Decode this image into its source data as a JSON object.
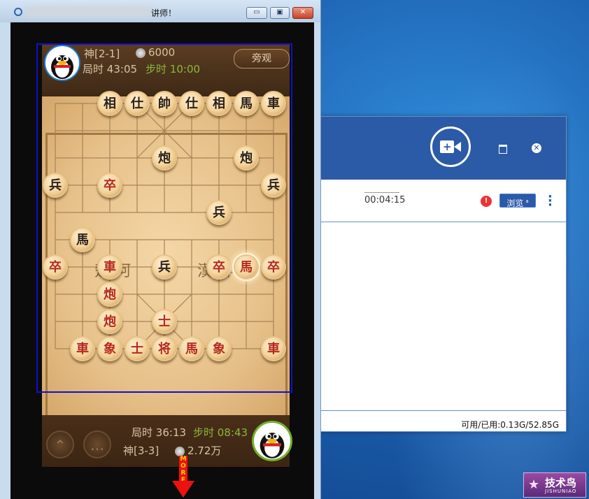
{
  "game_window": {
    "title_suffix": "讲师！",
    "controls": {
      "minimize": "▭",
      "maximize": "▣",
      "close": "✕"
    }
  },
  "top_player": {
    "rank": "神[2-1]",
    "coins": "6000",
    "game_time_label": "局时",
    "game_time": "43:05",
    "step_time_label": "步时",
    "step_time": "10:00"
  },
  "spectate_button": "旁观",
  "river": {
    "left": "楚河",
    "right": "漢界"
  },
  "bottom_player": {
    "rank": "神[3-3]",
    "coins": "2.72万",
    "game_time_label": "局时",
    "game_time": "36:13",
    "step_time_label": "步时",
    "step_time": "08:43"
  },
  "board_state": {
    "pieces": [
      {
        "char": "相",
        "side": "black",
        "col": 2,
        "row": 0
      },
      {
        "char": "仕",
        "side": "black",
        "col": 3,
        "row": 0
      },
      {
        "char": "帥",
        "side": "black",
        "col": 4,
        "row": 0
      },
      {
        "char": "仕",
        "side": "black",
        "col": 5,
        "row": 0
      },
      {
        "char": "相",
        "side": "black",
        "col": 6,
        "row": 0
      },
      {
        "char": "馬",
        "side": "black",
        "col": 7,
        "row": 0
      },
      {
        "char": "車",
        "side": "black",
        "col": 8,
        "row": 0
      },
      {
        "char": "炮",
        "side": "black",
        "col": 4,
        "row": 2
      },
      {
        "char": "炮",
        "side": "black",
        "col": 7,
        "row": 2
      },
      {
        "char": "兵",
        "side": "black",
        "col": 0,
        "row": 3
      },
      {
        "char": "卒",
        "side": "red",
        "col": 2,
        "row": 3
      },
      {
        "char": "兵",
        "side": "black",
        "col": 8,
        "row": 3
      },
      {
        "char": "兵",
        "side": "black",
        "col": 6,
        "row": 4
      },
      {
        "char": "馬",
        "side": "black",
        "col": 1,
        "row": 5
      },
      {
        "char": "卒",
        "side": "red",
        "col": 0,
        "row": 6
      },
      {
        "char": "車",
        "side": "red",
        "col": 2,
        "row": 6
      },
      {
        "char": "兵",
        "side": "black",
        "col": 4,
        "row": 6
      },
      {
        "char": "卒",
        "side": "red",
        "col": 6,
        "row": 6
      },
      {
        "char": "馬",
        "side": "red",
        "col": 7,
        "row": 6,
        "highlight": true
      },
      {
        "char": "卒",
        "side": "red",
        "col": 8,
        "row": 6
      },
      {
        "char": "炮",
        "side": "red",
        "col": 2,
        "row": 7
      },
      {
        "char": "炮",
        "side": "red",
        "col": 2,
        "row": 8
      },
      {
        "char": "士",
        "side": "red",
        "col": 4,
        "row": 8
      },
      {
        "char": "車",
        "side": "red",
        "col": 1,
        "row": 9
      },
      {
        "char": "象",
        "side": "red",
        "col": 2,
        "row": 9
      },
      {
        "char": "士",
        "side": "red",
        "col": 3,
        "row": 9
      },
      {
        "char": "将",
        "side": "red",
        "col": 4,
        "row": 9
      },
      {
        "char": "馬",
        "side": "red",
        "col": 5,
        "row": 9
      },
      {
        "char": "象",
        "side": "red",
        "col": 6,
        "row": 9
      },
      {
        "char": "車",
        "side": "red",
        "col": 8,
        "row": 9
      }
    ]
  },
  "more_tag": "MORE",
  "recorder": {
    "duration": "00:04:15",
    "browse_label": "浏览",
    "browse_badge": "a",
    "storage": "可用/已用:0.13G/52.85G"
  },
  "watermark": {
    "cn": "技术鸟",
    "en": "JISHUNIAO"
  }
}
